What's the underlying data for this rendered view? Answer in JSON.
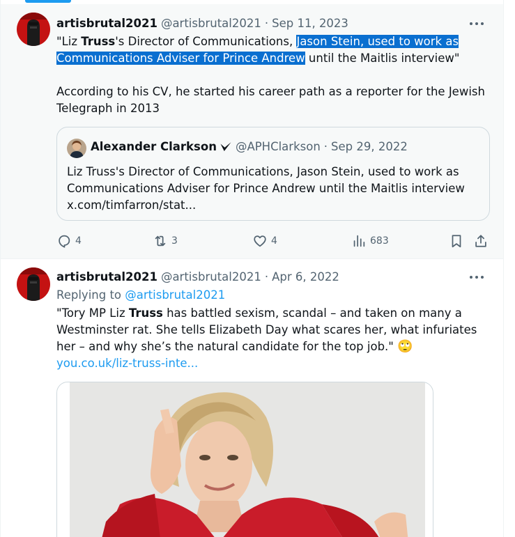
{
  "tweets": [
    {
      "display_name": "artisbrutal2021",
      "handle": "@artisbrutal2021",
      "separator": "·",
      "date": "Sep 11, 2023",
      "text": {
        "p1_a": "\"Liz ",
        "p1_bold": "Truss",
        "p1_b": "'s Director of Communications, ",
        "p1_highlight_1": "Jason Stein, used to work as",
        "p1_highlight_2": "Communications Adviser for Prince Andrew",
        "p1_c": " until the Maitlis interview\"",
        "p2": "According to his CV, he started his career path as a reporter for the Jewish Telegraph in 2013"
      },
      "quote": {
        "display_name": "Alexander Clarkson",
        "handle": "@APHClarkson",
        "separator": "·",
        "date": "Sep 29, 2022",
        "text_1": "Liz Truss's Director of Communications, Jason Stein, used to work as",
        "text_2": "Communications Adviser for Prince Andrew until the Maitlis interview",
        "text_3": "x.com/timfarron/stat..."
      },
      "actions": {
        "replies": "4",
        "reposts": "3",
        "likes": "4",
        "views": "683"
      }
    },
    {
      "display_name": "artisbrutal2021",
      "handle": "@artisbrutal2021",
      "separator": "·",
      "date": "Apr 6, 2022",
      "replying_label": "Replying to ",
      "replying_handle": "@artisbrutal2021",
      "text": {
        "a": "\"Tory MP Liz ",
        "bold": "Truss",
        "b": " has battled sexism, scandal – and taken on many a Westminster rat. She tells Elizabeth Day what scares her, what infuriates her – and why she’s the natural candidate for the top job.\" ",
        "emoji": "🙄",
        "link": "you.co.uk/liz-truss-inte..."
      }
    }
  ],
  "colors": {
    "accent": "#1d9bf0",
    "highlight": "#0a6fd0",
    "muted": "#536471",
    "verified": "#0f1419"
  }
}
